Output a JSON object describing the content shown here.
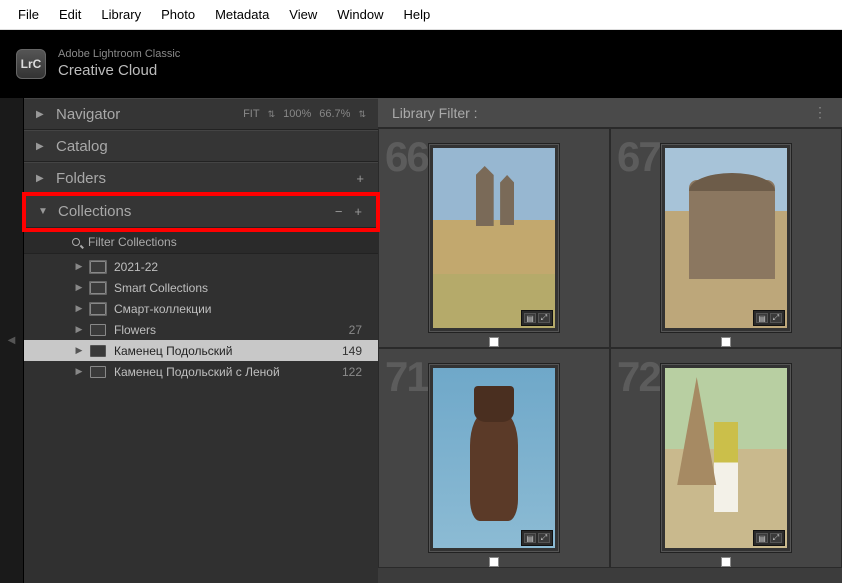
{
  "menu": {
    "items": [
      "File",
      "Edit",
      "Library",
      "Photo",
      "Metadata",
      "View",
      "Window",
      "Help"
    ]
  },
  "brand": {
    "logo": "LrC",
    "sub": "Adobe Lightroom Classic",
    "main": "Creative Cloud"
  },
  "panels": {
    "navigator": {
      "label": "Navigator",
      "fit": "FIT",
      "zoom1": "100%",
      "zoom2": "66.7%"
    },
    "catalog": {
      "label": "Catalog"
    },
    "folders": {
      "label": "Folders"
    },
    "collections": {
      "label": "Collections"
    }
  },
  "filter": {
    "placeholder": "Filter Collections"
  },
  "tree": [
    {
      "label": "2021-22",
      "count": "",
      "depth": 1,
      "stack": true
    },
    {
      "label": "Smart Collections",
      "count": "",
      "depth": 1,
      "stack": true
    },
    {
      "label": "Смарт-коллекции",
      "count": "",
      "depth": 1,
      "stack": true
    },
    {
      "label": "Flowers",
      "count": "27",
      "depth": 1,
      "stack": false
    },
    {
      "label": "Каменец Подольский",
      "count": "149",
      "depth": 1,
      "stack": false,
      "selected": true
    },
    {
      "label": "Каменец Подольский с Леной",
      "count": "122",
      "depth": 1,
      "stack": false
    }
  ],
  "library_filter": {
    "label": "Library Filter :"
  },
  "thumbs": [
    {
      "idx": "66",
      "class": "tower1"
    },
    {
      "idx": "67",
      "class": "tower2"
    },
    {
      "idx": "71",
      "class": "statue"
    },
    {
      "idx": "72",
      "class": "woman"
    }
  ],
  "icons": {
    "plus": "+",
    "minus": "−",
    "updown": "⇅",
    "tri_right": "▶",
    "tri_down": "▼",
    "handle": "◀"
  }
}
